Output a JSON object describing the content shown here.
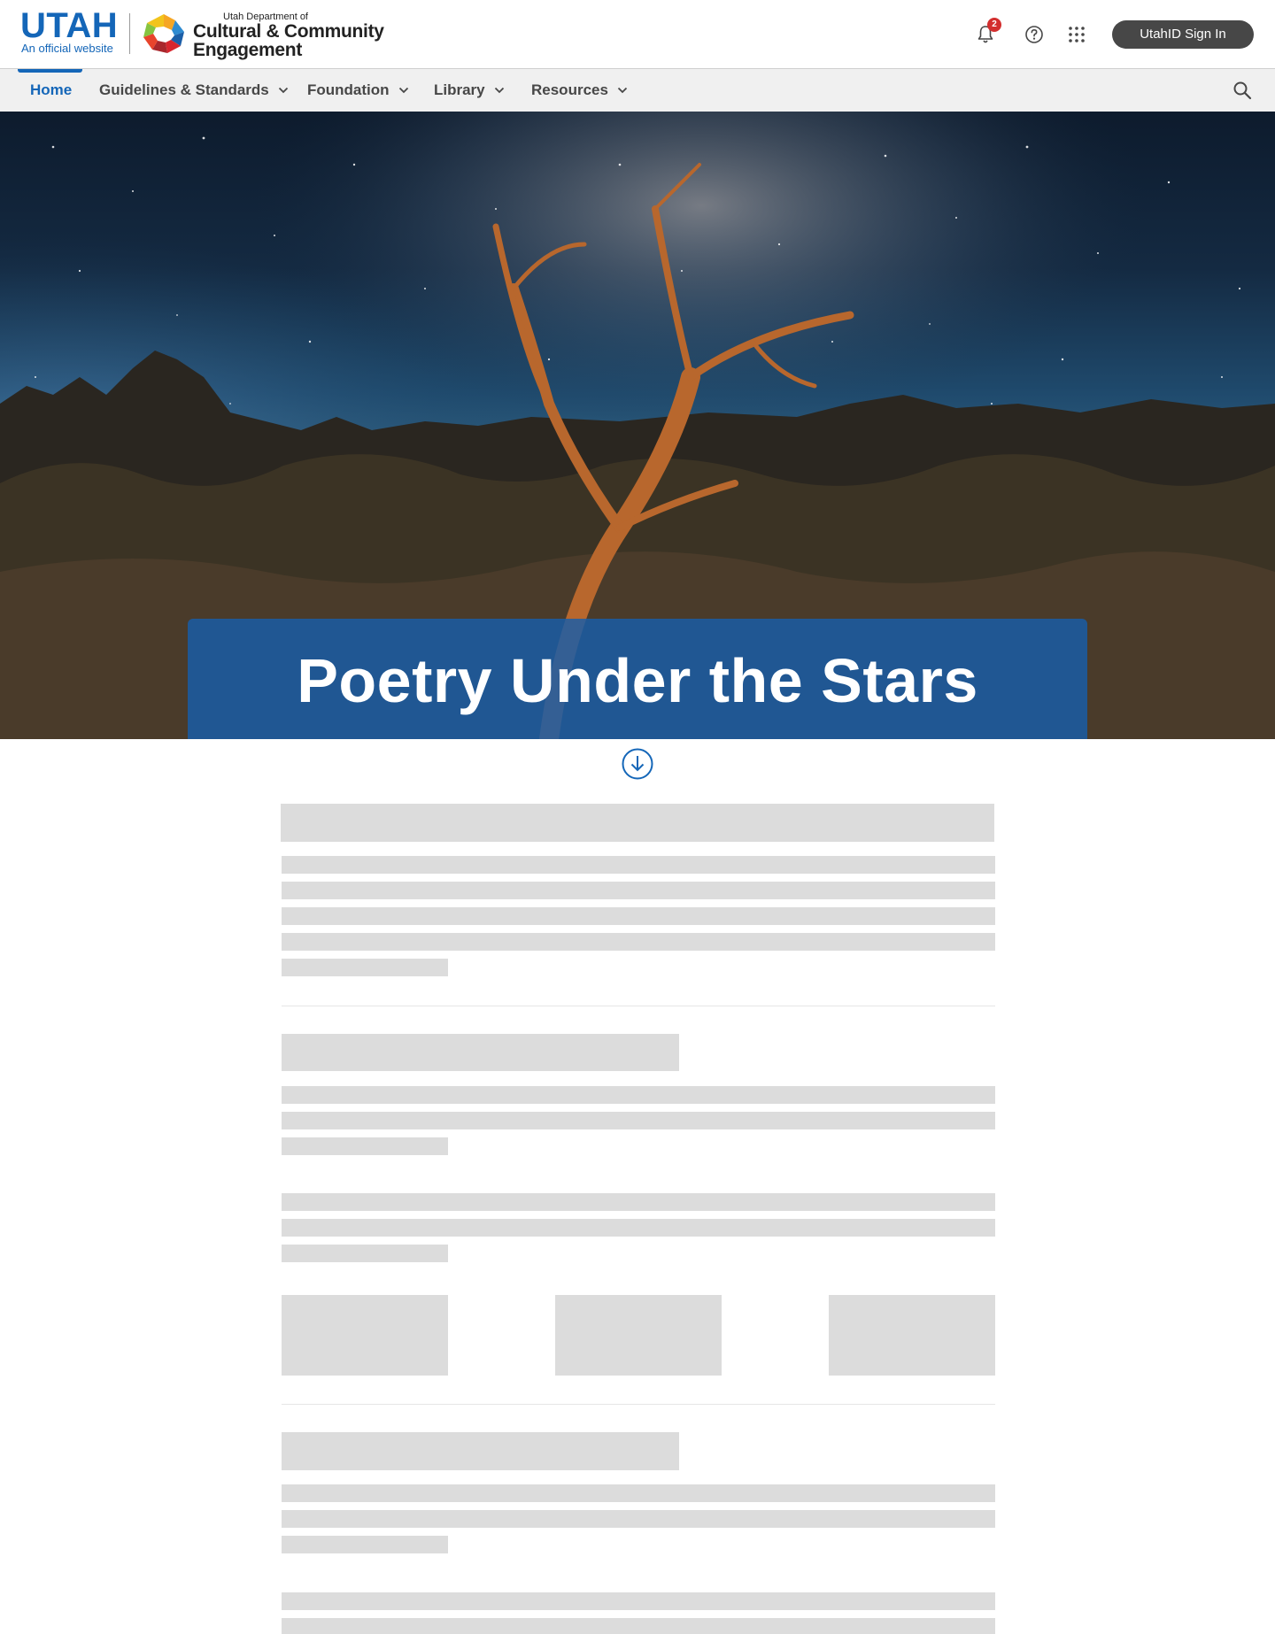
{
  "header": {
    "state_logo_text": "UTAH",
    "official_text": "An official website",
    "agency_small": "Utah Department of",
    "agency_line1": "Cultural & Community",
    "agency_line2": "Engagement",
    "notifications_count": "2",
    "signin_label": "UtahID Sign In",
    "icons": [
      "bell-icon",
      "help-icon",
      "apps-grid-icon"
    ]
  },
  "nav": {
    "items": [
      {
        "label": "Home",
        "active": true
      },
      {
        "label": "Guidelines & Standards",
        "has_menu": true
      },
      {
        "label": "Foundation",
        "has_menu": true
      },
      {
        "label": "Library",
        "has_menu": true
      },
      {
        "label": "Resources",
        "has_menu": true
      }
    ],
    "search_icon": "search-icon"
  },
  "hero": {
    "title": "Poetry Under the Stars"
  },
  "colors": {
    "brand_blue": "#1466b8",
    "title_box": "#175eab",
    "signin_bg": "#474747",
    "skeleton": "#dcdcdc",
    "badge": "#d32f2f"
  }
}
